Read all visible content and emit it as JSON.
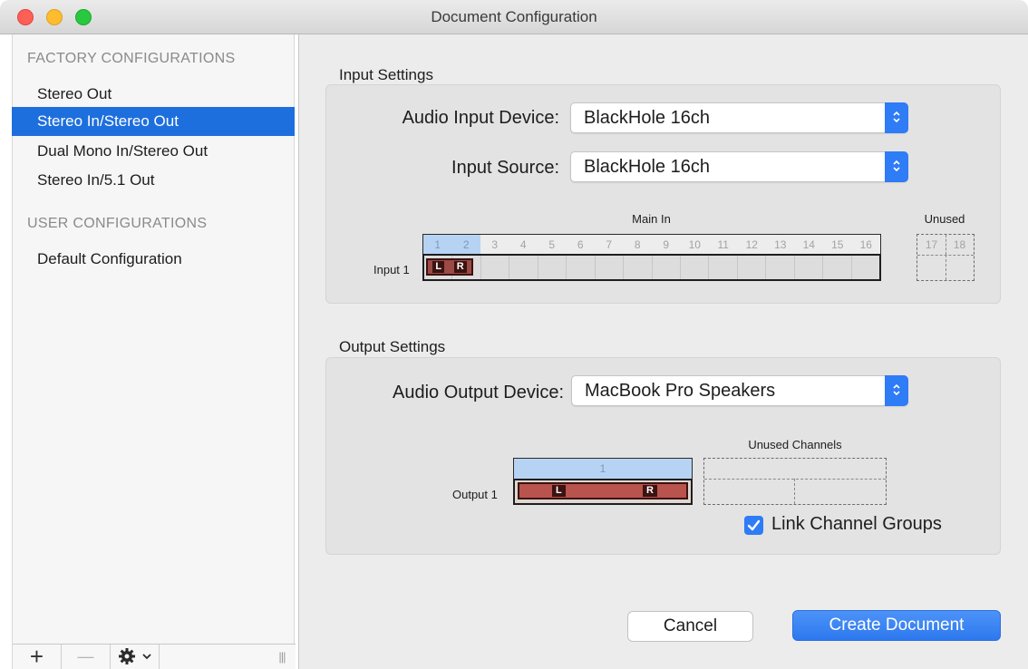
{
  "window": {
    "title": "Document Configuration"
  },
  "sidebar": {
    "factory_header": "FACTORY CONFIGURATIONS",
    "factory_items": [
      {
        "label": "Stereo Out",
        "selected": false
      },
      {
        "label": "Stereo In/Stereo Out",
        "selected": true
      },
      {
        "label": "Dual Mono In/Stereo Out",
        "selected": false
      },
      {
        "label": "Stereo In/5.1 Out",
        "selected": false
      }
    ],
    "user_header": "USER CONFIGURATIONS",
    "user_items": [
      {
        "label": "Default Configuration"
      }
    ],
    "toolbar": {
      "add": "+",
      "remove": "—",
      "gear": "gear-icon",
      "chevron": "⌄",
      "resize": "|||"
    }
  },
  "input": {
    "section_title": "Input Settings",
    "device_label": "Audio Input Device:",
    "device_value": "BlackHole 16ch",
    "source_label": "Input Source:",
    "source_value": "BlackHole 16ch",
    "main_in_label": "Main In",
    "unused_label": "Unused",
    "row_label": "Input 1",
    "channels": [
      "1",
      "2",
      "3",
      "4",
      "5",
      "6",
      "7",
      "8",
      "9",
      "10",
      "11",
      "12",
      "13",
      "14",
      "15",
      "16"
    ],
    "active_channels": 2,
    "unused_channels": [
      "17",
      "18"
    ],
    "chip_left": "L",
    "chip_right": "R"
  },
  "output": {
    "section_title": "Output Settings",
    "device_label": "Audio Output Device:",
    "device_value": "MacBook Pro Speakers",
    "unused_label": "Unused Channels",
    "row_label": "Output 1",
    "channel": "1",
    "chip_left": "L",
    "chip_right": "R",
    "link_label": "Link Channel Groups",
    "link_checked": true
  },
  "buttons": {
    "cancel": "Cancel",
    "create": "Create Document"
  },
  "colors": {
    "accent": "#2e7cf6",
    "selection": "#1e6fde",
    "chip": "#9b4a45"
  }
}
